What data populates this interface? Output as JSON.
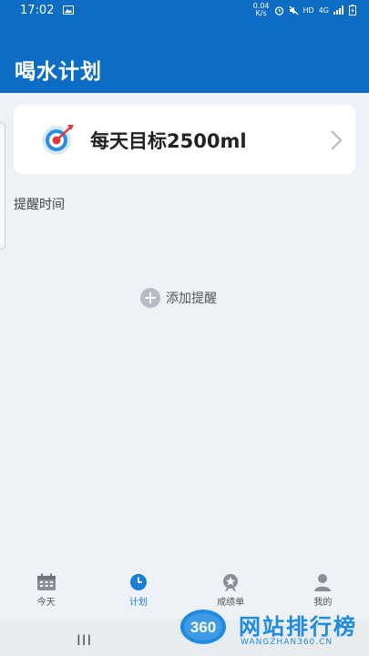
{
  "status_bar": {
    "time": "17:02",
    "speed": "0.04\nK/s",
    "hd": "HD",
    "net": "4G",
    "icons": [
      "image-icon",
      "alarm-icon",
      "mute-icon",
      "signal-icon",
      "battery-icon"
    ]
  },
  "app_bar": {
    "title": "喝水计划"
  },
  "goal_card": {
    "text": "每天目标2500ml",
    "icon": "target-icon"
  },
  "reminders": {
    "section_label": "提醒时间",
    "add_label": "添加提醒"
  },
  "tabs": [
    {
      "label": "今天",
      "icon": "calendar-icon",
      "active": false
    },
    {
      "label": "计划",
      "icon": "clock-icon",
      "active": true
    },
    {
      "label": "成绩单",
      "icon": "medal-icon",
      "active": false
    },
    {
      "label": "我的",
      "icon": "user-icon",
      "active": false
    }
  ],
  "nav": {
    "recents": "III"
  },
  "watermark": {
    "logo": "360",
    "text": "网站排行榜",
    "sub": "WANGZHAN360.CN"
  },
  "colors": {
    "primary": "#0d6cc4",
    "accent": "#1c7fd6",
    "background": "#eef1f5",
    "target_red": "#e0383e"
  }
}
